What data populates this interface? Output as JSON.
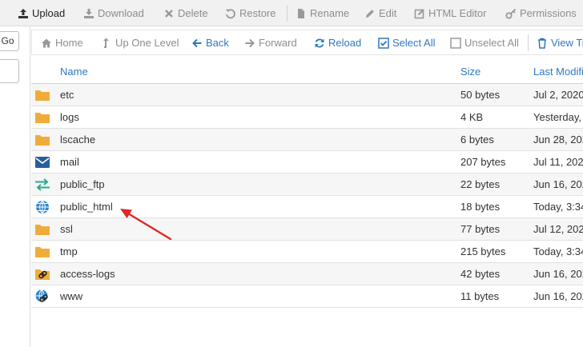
{
  "toolbar": {
    "upload": "Upload",
    "download": "Download",
    "delete": "Delete",
    "restore": "Restore",
    "rename": "Rename",
    "edit": "Edit",
    "html_editor": "HTML Editor",
    "permissions": "Permissions"
  },
  "left": {
    "go": "Go"
  },
  "nav": {
    "home": "Home",
    "up_one_level": "Up One Level",
    "back": "Back",
    "forward": "Forward",
    "reload": "Reload",
    "select_all": "Select All",
    "unselect_all": "Unselect All",
    "view_trash": "View Tr"
  },
  "table": {
    "headers": {
      "name": "Name",
      "size": "Size",
      "modified": "Last Modifi"
    },
    "rows": [
      {
        "icon": "folder-icon",
        "name": "etc",
        "size": "50 bytes",
        "modified": "Jul 2, 2020"
      },
      {
        "icon": "folder-icon",
        "name": "logs",
        "size": "4 KB",
        "modified": "Yesterday,"
      },
      {
        "icon": "folder-icon",
        "name": "lscache",
        "size": "6 bytes",
        "modified": "Jun 28, 202"
      },
      {
        "icon": "mail-icon",
        "name": "mail",
        "size": "207 bytes",
        "modified": "Jul 11, 202"
      },
      {
        "icon": "ftp-arrows-icon",
        "name": "public_ftp",
        "size": "22 bytes",
        "modified": "Jun 16, 202"
      },
      {
        "icon": "globe-icon",
        "name": "public_html",
        "size": "18 bytes",
        "modified": "Today, 3:34"
      },
      {
        "icon": "folder-icon",
        "name": "ssl",
        "size": "77 bytes",
        "modified": "Jul 12, 202"
      },
      {
        "icon": "folder-icon",
        "name": "tmp",
        "size": "215 bytes",
        "modified": "Today, 3:34"
      },
      {
        "icon": "folder-link-icon",
        "name": "access-logs",
        "size": "42 bytes",
        "modified": "Jun 16, 202"
      },
      {
        "icon": "globe-link-icon",
        "name": "www",
        "size": "11 bytes",
        "modified": "Jun 16, 202"
      }
    ]
  },
  "colors": {
    "link_blue": "#2f78bf",
    "folder": "#f0ac3a",
    "mail": "#2a5d9f",
    "ftp": "#2bab8f",
    "globe": "#2f86c8",
    "annotation_arrow": "#e02626"
  }
}
